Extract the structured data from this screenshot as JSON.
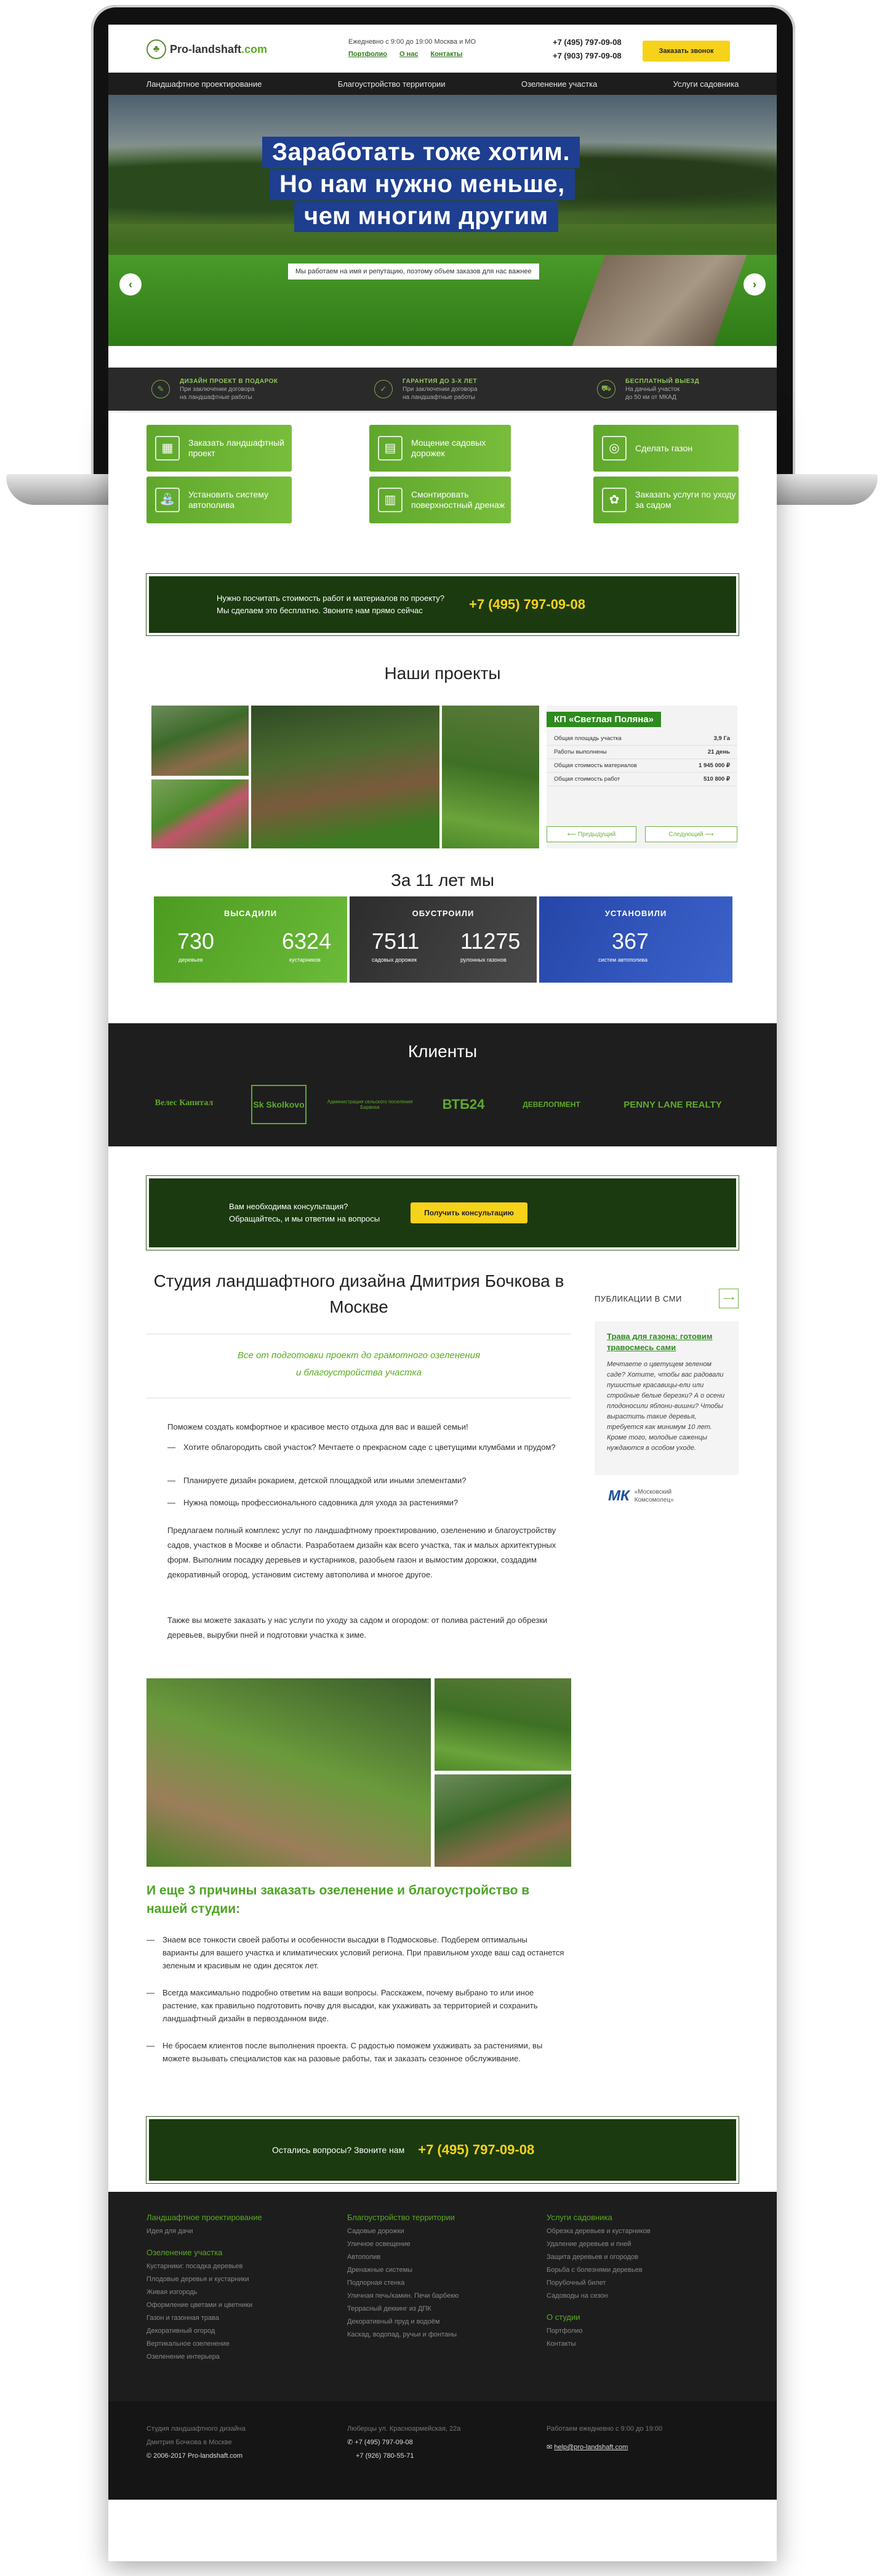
{
  "header": {
    "logo_text_dark": "Pro-landshaft",
    "logo_text_green": ".com",
    "hours": "Ежедневно с 9:00 до 19:00   Москва и МО",
    "links": [
      "Портфолио",
      "О нас",
      "Контакты"
    ],
    "phone1": "+7 (495) 797-09-08",
    "phone2": "+7 (903) 797-09-08",
    "call_button": "Заказать звонок"
  },
  "nav": [
    "Ландшафтное проектирование",
    "Благоустройство территории",
    "Озеленение участка",
    "Услуги садовника"
  ],
  "hero": {
    "lines": [
      "Заработать тоже хотим.",
      "Но нам нужно меньше,",
      "чем многим другим"
    ],
    "sub": "Мы работаем на имя и репутацию, поэтому объем заказов для нас важнее"
  },
  "perks": [
    {
      "title": "ДИЗАЙН ПРОЕКТ В ПОДАРОК",
      "text1": "При заключении договора",
      "text2": "на ландшафтные работы"
    },
    {
      "title": "ГАРАНТИЯ ДО 3-Х ЛЕТ",
      "text1": "При заключении договора",
      "text2": "на ландшафтные работы"
    },
    {
      "title": "БЕСПЛАТНЫЙ ВЫЕЗД",
      "text1": "На дачный участок",
      "text2": "до 50 км от МКАД"
    }
  ],
  "services": [
    "Заказать ландшафтный проект",
    "Мощение садовых дорожек",
    "Сделать газон",
    "Установить систему автополива",
    "Смонтировать поверхностный дренаж",
    "Заказать услуги по уходу за садом"
  ],
  "cta1": {
    "line1": "Нужно посчитать стоимость работ и материалов по проекту?",
    "line2": "Мы сделаем это бесплатно. Звоните нам прямо сейчас",
    "phone": "+7 (495) 797-09-08"
  },
  "projects": {
    "heading": "Наши проекты",
    "title": "КП «Светлая Поляна»",
    "rows": [
      [
        "Общая площадь участка",
        "3,9 Га"
      ],
      [
        "Работы выполнены",
        "21 день"
      ],
      [
        "Общая стоимость материалов",
        "1 945 000 ₽"
      ],
      [
        "Общая стоимость работ",
        "510 800 ₽"
      ]
    ],
    "prev": "Предыдущий",
    "next": "Следующий"
  },
  "stats": {
    "heading": "За 11 лет мы",
    "blocks": [
      {
        "caption": "ВЫСАДИЛИ",
        "n1": "730",
        "l1": "деревьев",
        "n2": "6324",
        "l2": "кустарников",
        "color": "#5aab21"
      },
      {
        "caption": "ОБУСТРОИЛИ",
        "n1": "7511",
        "l1": "садовых дорожек",
        "n2": "11275",
        "l2": "рулонных газонов",
        "color": "#3a3a3a"
      },
      {
        "caption": "УСТАНОВИЛИ",
        "n1": "367",
        "l1": "систем автополива",
        "color": "#2d4fb1"
      }
    ]
  },
  "clients": {
    "heading": "Клиенты",
    "logos": [
      "Велес Капитал",
      "Sk Skolkovo",
      "Администрация сельского поселения Барвиха",
      "ВТБ24",
      "ДЕВЕЛОПМЕНТ",
      "PENNY LANE REALTY"
    ]
  },
  "cta2": {
    "line1": "Вам необходима консультация?",
    "line2": "Обращайтесь, и мы ответим на вопросы",
    "button": "Получить консультацию"
  },
  "article": {
    "title": "Студия ландшафтного дизайна Дмитрия Бочкова в Москве",
    "lead1": "Все от подготовки проект до грамотного озеленения",
    "lead2": "и благоустройства участка",
    "intro": "Поможем создать комфортное и красивое место отдыха для вас и вашей семьи!",
    "bullets": [
      "Хотите облагородить свой участок? Мечтаете о прекрасном саде с цветущими клумбами и прудом?",
      "Планируете дизайн рокарием, детской площадкой или иными элементами?",
      "Нужна помощь профессионального садовника для ухода за растениями?"
    ],
    "p1": "Предлагаем полный комплекс услуг по ландшафтному проектированию, озеленению и благоустройству садов, участков в Москве и области. Разработаем дизайн как всего участка, так и малых архитектурных форм. Выполним посадку деревьев и кустарников, разобьем газон и вымостим дорожки, создадим декоративный огород, установим систему автополива и многое другое.",
    "p2": "Также вы можете заказать у нас услуги по уходу за садом и огородом: от полива растений до обрезки деревьев, вырубки пней и подготовки участка к зиме.",
    "reasons_title": "И еще 3 причины заказать озеленение и благоустройство в нашей студии:",
    "reasons": [
      "Знаем все тонкости своей работы и особенности высадки в Подмосковье. Подберем оптимальны варианты для вашего участка и климатических условий региона. При правильном уходе ваш сад останется зеленым и красивым не один десяток лет.",
      "Всегда максимально подробно ответим на ваши вопросы. Расскажем, почему выбрано то или иное растение, как правильно подготовить почву для высадки, как ухаживать за территорией и сохранить ландшафтный дизайн в первозданном виде.",
      "Не бросаем клиентов после выполнения проекта. С радостью поможем ухаживать за растениями, вы можете вызывать специалистов как на разовые работы, так и заказать сезонное обслуживание."
    ]
  },
  "sidebar": {
    "heading": "ПУБЛИКАЦИИ В СМИ",
    "link": "Трава для газона: готовим травосмесь сами",
    "quote": "Мечтаете о цветущем зеленом саде? Хотите, чтобы вас радовали пушистые красавицы-ели или стройные белые березки? А о осени плодоносили яблони-вишни? Чтобы вырастить такие деревья, требуется как минимум 10 лет. Кроме того, молодые саженцы нуждаются в особом уходе.",
    "source": "«Московский Комсомолец»",
    "source_logo": "МК"
  },
  "cta3": {
    "text": "Остались вопросы? Звоните нам",
    "phone": "+7 (495) 797-09-08"
  },
  "footer": {
    "col1": {
      "h1": "Ландшафтное проектирование",
      "i1": [
        "Идея для дачи"
      ],
      "h2": "Озеленение участка",
      "i2": [
        "Кустарники: посадка деревьев",
        "Плодовые деревья и кустарники",
        "Живая изгородь",
        "Оформление цветами и цветники",
        "Газон и газонная трава",
        "Декоративный огород",
        "Вертикальное озеленение",
        "Озеленение интерьера"
      ]
    },
    "col2": {
      "h": "Благоустройство территории",
      "items": [
        "Садовые дорожки",
        "Уличное освещение",
        "Автополив",
        "Дренажные системы",
        "Подпорная стенка",
        "Уличная печь/камин. Печи барбекю",
        "Террасный деккинг из ДПК",
        "Декоративный пруд и водоём",
        "Каскад, водопад, ручьи и фонтаны"
      ]
    },
    "col3": {
      "h1": "Услуги садовника",
      "i1": [
        "Обрезка деревьев и кустарников",
        "Удаление деревьев и пней",
        "Защита деревьев и огородов",
        "Борьба с болезнями деревьев",
        "Порубочный билет",
        "Садоводы на сезон"
      ],
      "h2": "О студии",
      "i2": [
        "Портфолио",
        "Контакты"
      ]
    }
  },
  "footer2": {
    "studio1": "Студия ландшафтного дизайна",
    "studio2": "Дмитрия Бочкова в Москве",
    "copy": "© 2006-2017 Pro-landshaft.com",
    "address": "Люберцы ул. Красноармейская, 22а",
    "phone1": "+7 (495) 797-09-08",
    "phone2": "+7 (926) 780-55-71",
    "hours": "Работаем ежедневно с 9:00 до 19:00",
    "email": "help@pro-landshaft.com"
  }
}
